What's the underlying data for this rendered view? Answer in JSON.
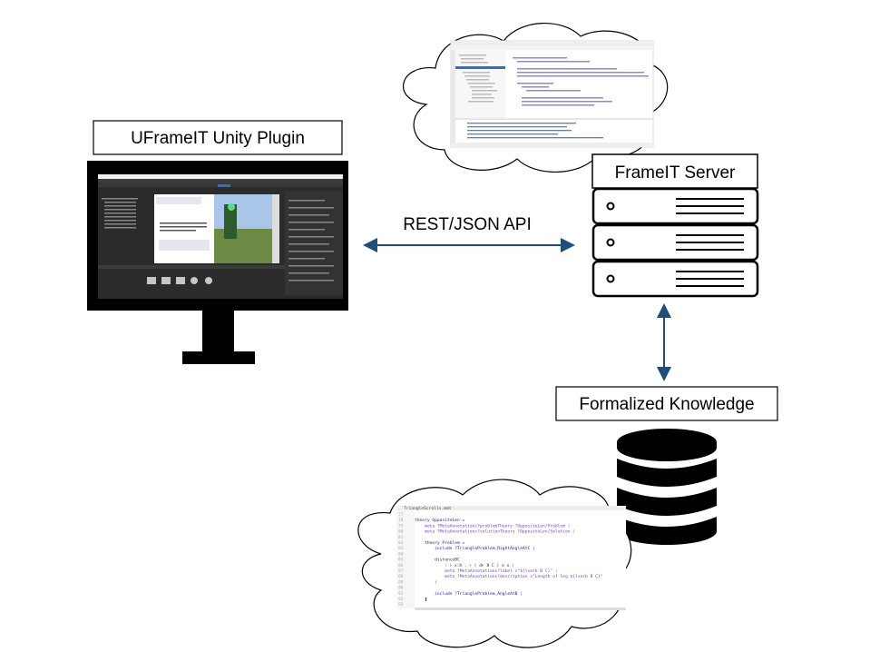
{
  "labels": {
    "unity_plugin": "UFrameIT Unity Plugin",
    "api": "REST/JSON API",
    "server": "FrameIT Server",
    "knowledge": "Formalized Knowledge"
  },
  "code_editor": {
    "tab": "TriangleScrolls.mmt",
    "line_numbers": [
      "77",
      "78",
      "79",
      "80",
      "81",
      "82",
      "83",
      "84",
      "85",
      "86",
      "87",
      "88",
      "89",
      "90",
      "91",
      "92",
      "93"
    ],
    "lines": [
      "",
      "theory OppositeLen =",
      "    meta ?MetaAnnotations?problemTheory ?OppositeLen/Problem ❘",
      "    meta ?MetaAnnotations?solutionTheory ?OppositeLen/Solution ❘",
      "",
      "    theory Problem =",
      "        include ?TriangleProblem_RightAngleAtC ❘",
      "",
      "        distanceBC",
      "            : ⊦ x:ℝ . ⊦ ( d⊢ B C ) ≐ x ❘",
      "            meta ?MetaAnnotations?label s\"${lverb B C}\" ❘",
      "            meta ?MetaAnnotations?description s\"Length of leg ${lverb B C}\"",
      "        ❘",
      "",
      "        include ?TriangleProblem_AngleAtB ❘",
      "    ❚",
      ""
    ]
  },
  "colors": {
    "arrow": "#1f4e79",
    "keyword": "#1a1aa6",
    "path": "#7a3fd0"
  }
}
